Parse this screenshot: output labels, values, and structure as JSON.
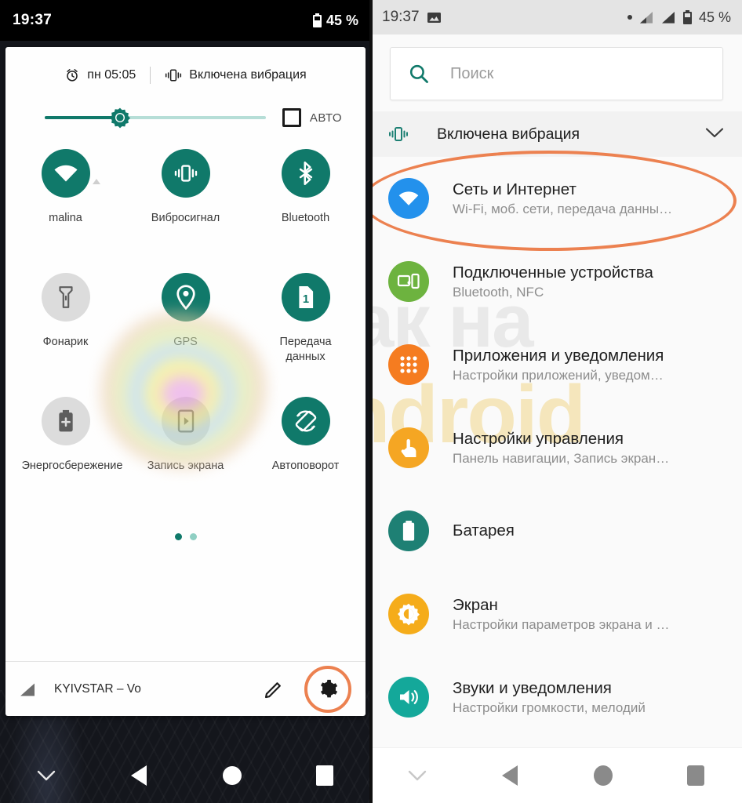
{
  "left": {
    "statusbar": {
      "clock": "19:37",
      "battery_pct": "45 %"
    },
    "shade_header": {
      "alarm_icon": "alarm-clock-icon",
      "alarm_time": "пн 05:05",
      "vibration_icon": "vibration-icon",
      "vibration_text": "Включена вибрация"
    },
    "brightness": {
      "slider_icon": "brightness-sun-icon",
      "value_percent": 34,
      "auto_label": "АВТО",
      "auto_checked": false
    },
    "tiles": [
      {
        "label": "malina",
        "icon": "wifi-icon",
        "state": "on",
        "has_sub_arrow": true
      },
      {
        "label": "Вибросигнал",
        "icon": "vibration-icon",
        "state": "on",
        "has_sub_arrow": false
      },
      {
        "label": "Bluetooth",
        "icon": "bluetooth-icon",
        "state": "on",
        "has_sub_arrow": false
      },
      {
        "label": "Фонарик",
        "icon": "flashlight-icon",
        "state": "off",
        "has_sub_arrow": false
      },
      {
        "label": "GPS",
        "icon": "location-pin-icon",
        "state": "on",
        "has_sub_arrow": false
      },
      {
        "label": "Передача данных",
        "icon": "sim-card-1-icon",
        "state": "on",
        "has_sub_arrow": false
      },
      {
        "label": "Энергосбережение",
        "icon": "battery-plus-icon",
        "state": "off",
        "has_sub_arrow": false
      },
      {
        "label": "Запись экрана",
        "icon": "screen-record-icon",
        "state": "off",
        "has_sub_arrow": false
      },
      {
        "label": "Автоповорот",
        "icon": "auto-rotate-icon",
        "state": "on",
        "has_sub_arrow": false
      }
    ],
    "pager": {
      "pages": 2,
      "active": 1
    },
    "footer": {
      "signal_icon": "signal-icon",
      "carrier": "KYIVSTAR – Vo",
      "edit_icon": "pencil-edit-icon",
      "settings_icon": "gear-icon",
      "settings_highlighted": true
    },
    "navbar": {
      "hide_icon": "chevron-down-icon",
      "back_icon": "back-triangle-icon",
      "home_icon": "home-circle-icon",
      "recents_icon": "recents-square-icon"
    }
  },
  "right": {
    "statusbar": {
      "clock": "19:37",
      "image_icon": "photo-icon",
      "dot_icon": "dot-icon",
      "sim1_icon": "signal-icon",
      "sim2_icon": "signal-icon",
      "battery_pct": "45 %"
    },
    "search": {
      "icon": "search-icon",
      "placeholder": "Поиск",
      "value": ""
    },
    "vibration_row": {
      "icon": "vibration-icon",
      "text": "Включена вибрация",
      "chevron": "chevron-down-icon"
    },
    "items": [
      {
        "title": "Сеть и Интернет",
        "desc": "Wi-Fi, моб. сети, передача данны…",
        "icon": "wifi-icon",
        "color": "#2391EC",
        "highlighted": true
      },
      {
        "title": "Подключенные устройства",
        "desc": "Bluetooth, NFC",
        "icon": "connected-devices-icon",
        "color": "#6DB33F",
        "highlighted": false
      },
      {
        "title": "Приложения и уведомления",
        "desc": "Настройки приложений, уведом…",
        "icon": "apps-grid-icon",
        "color": "#F57C20",
        "highlighted": false
      },
      {
        "title": "Настройки управления",
        "desc": "Панель навигации, Запись экран…",
        "icon": "hand-tap-icon",
        "color": "#F5A623",
        "highlighted": false
      },
      {
        "title": "Батарея",
        "desc": "",
        "icon": "battery-icon",
        "color": "#1E8074",
        "highlighted": false
      },
      {
        "title": "Экран",
        "desc": "Настройки параметров экрана и …",
        "icon": "brightness-sun-icon",
        "color": "#F5AC1A",
        "highlighted": false
      },
      {
        "title": "Звуки и уведомления",
        "desc": "Настройки громкости, мелодий",
        "icon": "volume-icon",
        "color": "#14A89A",
        "highlighted": false
      }
    ],
    "navbar": {
      "hide_icon": "chevron-down-icon",
      "back_icon": "back-triangle-icon",
      "home_icon": "home-circle-icon",
      "recents_icon": "recents-square-icon"
    }
  },
  "watermark": {
    "grey_text": "как на",
    "yellow_text": "android"
  },
  "colors": {
    "accent_teal": "#10796a",
    "highlight_orange": "#ec8150",
    "tile_off_grey": "#dcdcdc",
    "blue": "#2391EC"
  }
}
